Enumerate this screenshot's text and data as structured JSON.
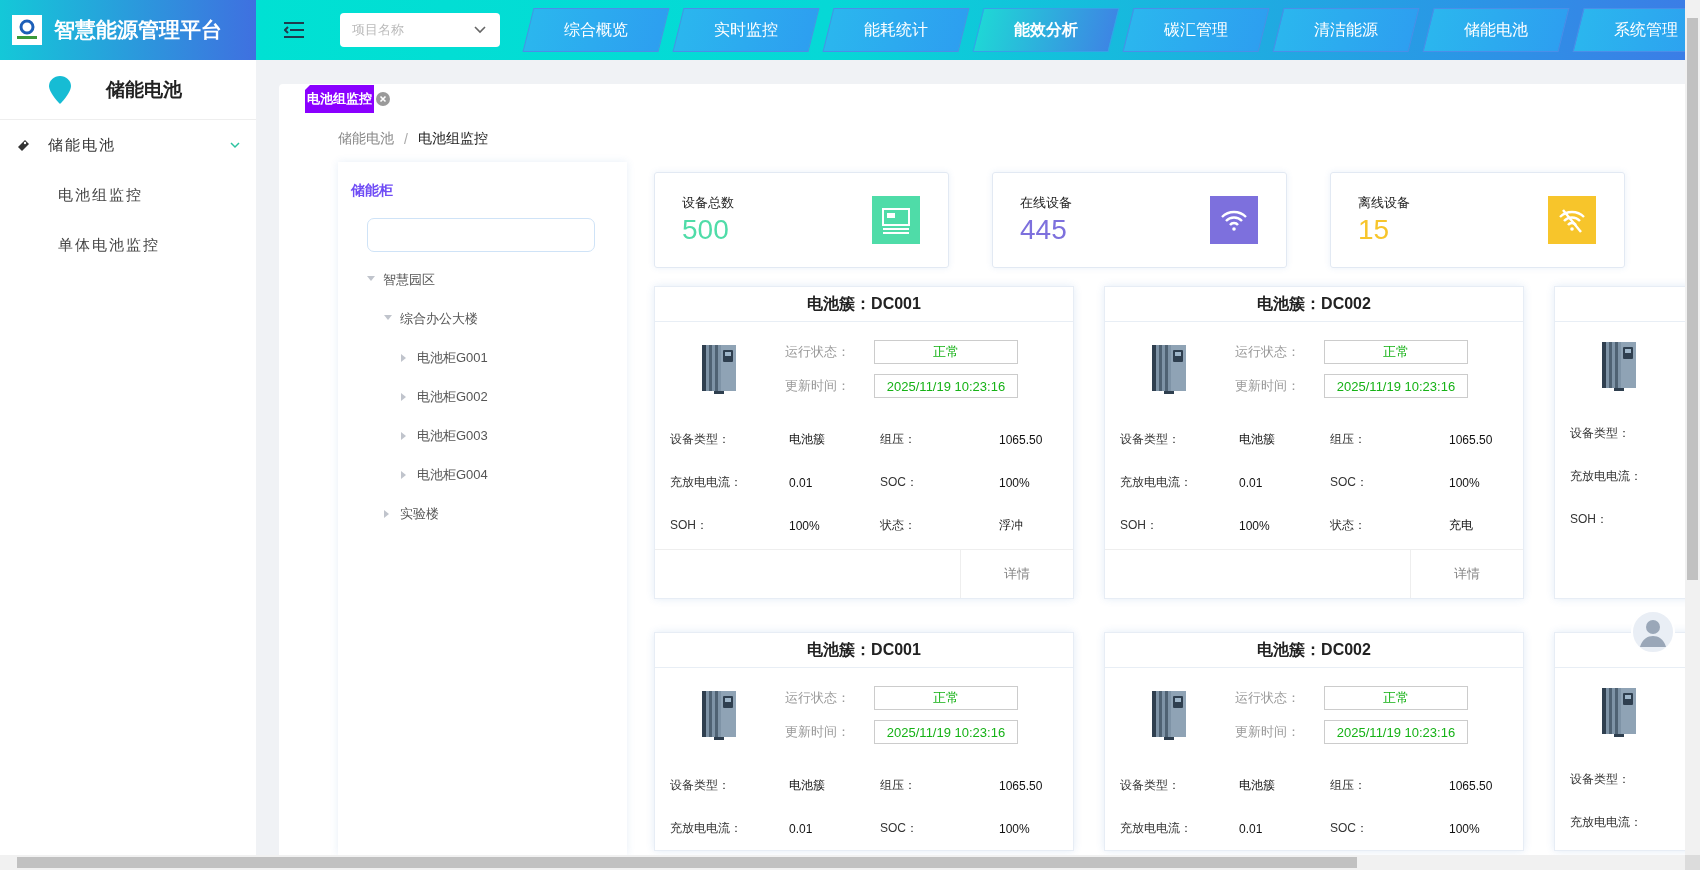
{
  "header": {
    "title": "智慧能源管理平台",
    "project_select": {
      "placeholder": "项目名称"
    },
    "nav": [
      {
        "label": "综合概览",
        "selected": false
      },
      {
        "label": "实时监控",
        "selected": false
      },
      {
        "label": "能耗统计",
        "selected": false
      },
      {
        "label": "能效分析",
        "selected": true
      },
      {
        "label": "碳汇管理",
        "selected": false
      },
      {
        "label": "清洁能源",
        "selected": false
      },
      {
        "label": "储能电池",
        "selected": false
      },
      {
        "label": "系统管理",
        "selected": false
      }
    ]
  },
  "sidebar": {
    "title": "储能电池",
    "menu": [
      {
        "label": "储能电池",
        "expanded": true,
        "children": [
          {
            "label": "电池组监控"
          },
          {
            "label": "单体电池监控"
          }
        ]
      }
    ]
  },
  "tabs": [
    {
      "label": "电池组监控",
      "selected": true
    }
  ],
  "breadcrumb": {
    "items": [
      "储能电池",
      "电池组监控"
    ],
    "separator": "/"
  },
  "tree": {
    "title": "储能柜",
    "items": [
      {
        "label": "智慧园区",
        "expanded": true,
        "children": [
          {
            "label": "综合办公大楼",
            "expanded": true,
            "children": [
              {
                "label": "电池柜G001",
                "expanded": false
              },
              {
                "label": "电池柜G002",
                "expanded": false
              },
              {
                "label": "电池柜G003",
                "expanded": false
              },
              {
                "label": "电池柜G004",
                "expanded": false
              }
            ]
          },
          {
            "label": "实验楼",
            "expanded": false
          }
        ]
      }
    ]
  },
  "stats": [
    {
      "label": "设备总数",
      "value": "500",
      "kind": "screen",
      "color": "#4fdca8"
    },
    {
      "label": "在线设备",
      "value": "445",
      "kind": "wifi",
      "color": "#7d70dd"
    },
    {
      "label": "离线设备",
      "value": "15",
      "kind": "wifi-off",
      "color": "#f7c52b"
    }
  ],
  "clusters": [
    {
      "title": "电池簇：DC001",
      "status_label": "运行状态：",
      "status": "正常",
      "time_label": "更新时间：",
      "time": "2025/11/19 10:23:16",
      "fields": [
        {
          "label": "设备类型：",
          "value": "电池簇"
        },
        {
          "label": "组压：",
          "value": "1065.50"
        },
        {
          "label": "充放电电流：",
          "value": "0.01"
        },
        {
          "label": "SOC：",
          "value": "100%"
        },
        {
          "label": "SOH：",
          "value": "100%"
        },
        {
          "label": "状态：",
          "value": "浮冲"
        }
      ],
      "detail_button": "详情"
    },
    {
      "title": "电池簇：DC002",
      "status_label": "运行状态：",
      "status": "正常",
      "time_label": "更新时间：",
      "time": "2025/11/19 10:23:16",
      "fields": [
        {
          "label": "设备类型：",
          "value": "电池簇"
        },
        {
          "label": "组压：",
          "value": "1065.50"
        },
        {
          "label": "充放电电流：",
          "value": "0.01"
        },
        {
          "label": "SOC：",
          "value": "100%"
        },
        {
          "label": "SOH：",
          "value": "100%"
        },
        {
          "label": "状态：",
          "value": "充电"
        }
      ],
      "detail_button": "详情"
    },
    {
      "fields": [
        {
          "label": "设备类型："
        },
        {
          "label": "充放电电流："
        },
        {
          "label": "SOH："
        }
      ]
    },
    {
      "title": "电池簇：DC001",
      "status_label": "运行状态：",
      "status": "正常",
      "time_label": "更新时间：",
      "time": "2025/11/19 10:23:16",
      "fields": [
        {
          "label": "设备类型：",
          "value": "电池簇"
        },
        {
          "label": "组压：",
          "value": "1065.50"
        },
        {
          "label": "充放电电流：",
          "value": "0.01"
        },
        {
          "label": "SOC：",
          "value": "100%"
        }
      ]
    },
    {
      "title": "电池簇：DC002",
      "status_label": "运行状态：",
      "status": "正常",
      "time_label": "更新时间：",
      "time": "2025/11/19 10:23:16",
      "fields": [
        {
          "label": "设备类型：",
          "value": "电池簇"
        },
        {
          "label": "组压：",
          "value": "1065.50"
        },
        {
          "label": "充放电电流：",
          "value": "0.01"
        },
        {
          "label": "SOC：",
          "value": "100%"
        }
      ]
    },
    {
      "fields": [
        {
          "label": "设备类型："
        },
        {
          "label": "充放电电流："
        }
      ]
    }
  ]
}
